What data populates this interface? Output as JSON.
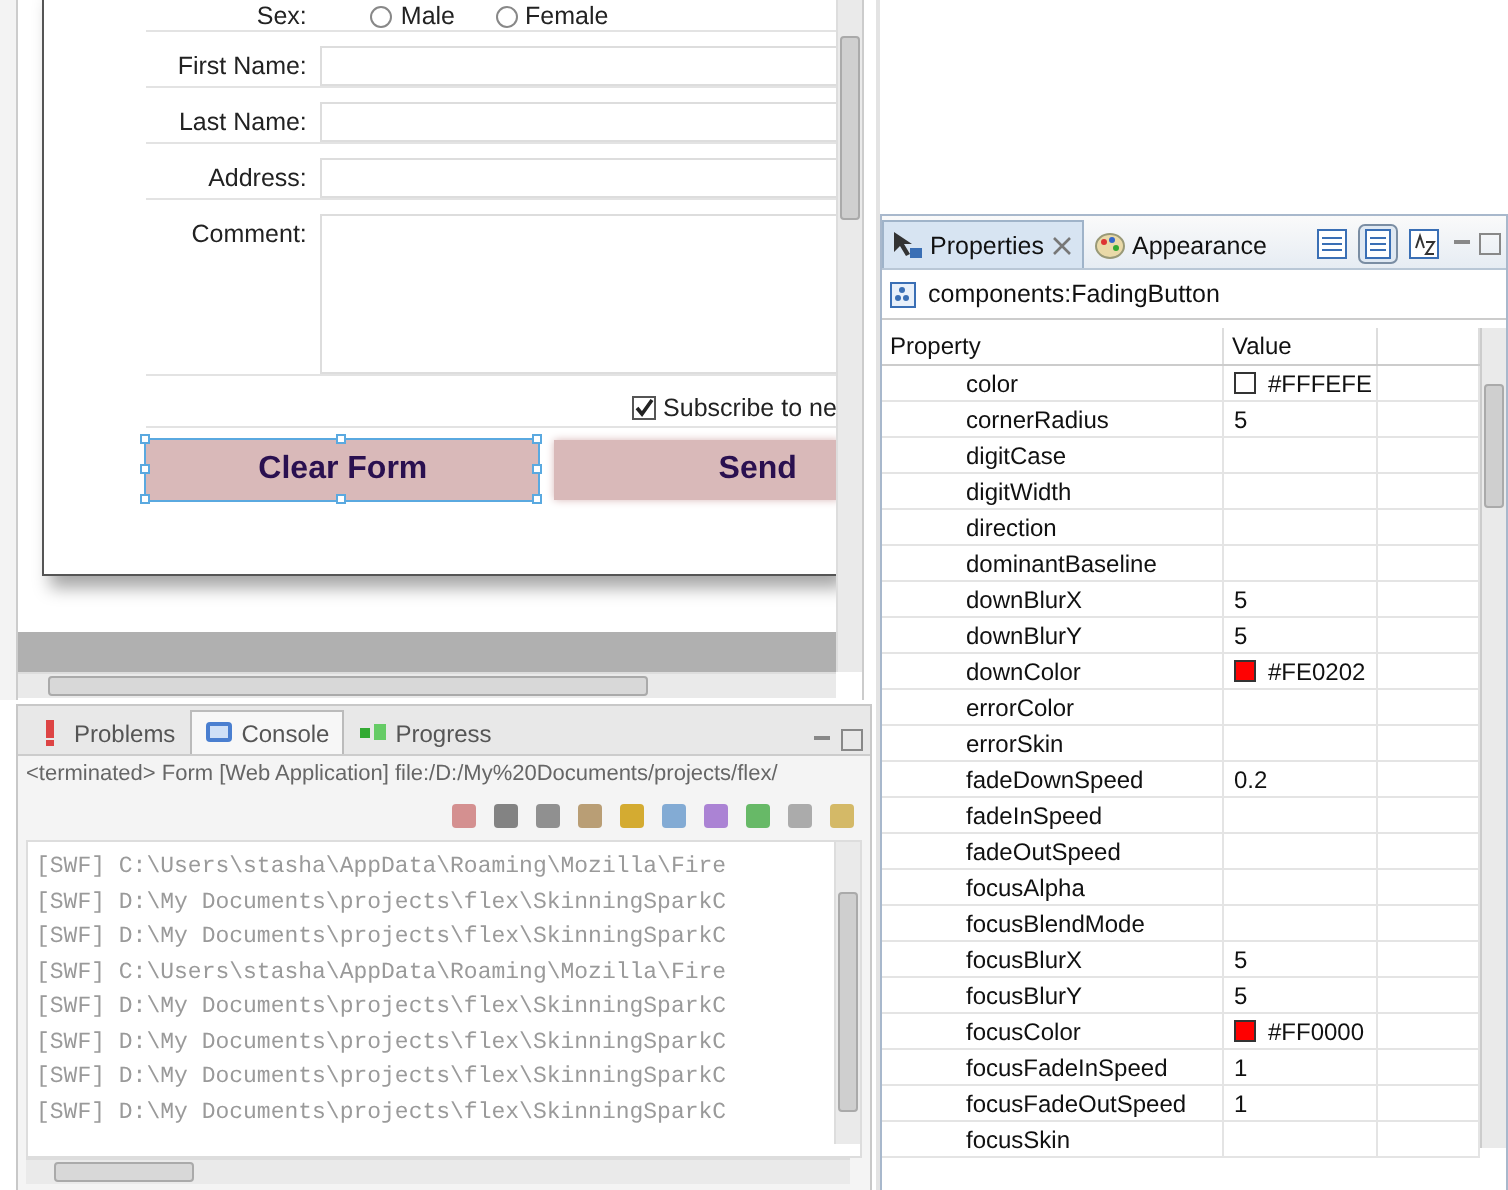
{
  "form": {
    "sex_label": "Sex:",
    "sex_options": [
      {
        "label": "Male",
        "selected": false
      },
      {
        "label": "Female",
        "selected": false
      }
    ],
    "fields": [
      {
        "label": "First Name:",
        "kind": "text"
      },
      {
        "label": "Last Name:",
        "kind": "text"
      },
      {
        "label": "Address:",
        "kind": "text"
      },
      {
        "label": "Comment:",
        "kind": "textarea"
      }
    ],
    "subscribe": {
      "label": "Subscribe to ne",
      "checked": true
    },
    "buttons": [
      {
        "label": "Clear Form",
        "selected": true
      },
      {
        "label": "Send",
        "selected": false
      }
    ]
  },
  "console": {
    "tabs": [
      {
        "label": "Problems",
        "selected": false
      },
      {
        "label": "Console",
        "selected": true
      },
      {
        "label": "Progress",
        "selected": false
      }
    ],
    "status": "<terminated> Form [Web Application] file:/D:/My%20Documents/projects/flex/",
    "lines": [
      "[SWF] C:\\Users\\stasha\\AppData\\Roaming\\Mozilla\\Fire",
      "[SWF] D:\\My Documents\\projects\\flex\\SkinningSparkC",
      "[SWF] D:\\My Documents\\projects\\flex\\SkinningSparkC",
      "[SWF] C:\\Users\\stasha\\AppData\\Roaming\\Mozilla\\Fire",
      "[SWF] D:\\My Documents\\projects\\flex\\SkinningSparkC",
      "[SWF] D:\\My Documents\\projects\\flex\\SkinningSparkC",
      "[SWF] D:\\My Documents\\projects\\flex\\SkinningSparkC",
      "[SWF] D:\\My Documents\\projects\\flex\\SkinningSparkC"
    ]
  },
  "properties": {
    "tabs": [
      {
        "label": "Properties",
        "selected": true
      },
      {
        "label": "Appearance",
        "selected": false
      }
    ],
    "component": "components:FadingButton",
    "columns": [
      "Property",
      "Value"
    ],
    "rows": [
      {
        "name": "color",
        "value": "#FFFEFE",
        "color": "#fffefe"
      },
      {
        "name": "cornerRadius",
        "value": "5"
      },
      {
        "name": "digitCase"
      },
      {
        "name": "digitWidth"
      },
      {
        "name": "direction"
      },
      {
        "name": "dominantBaseline"
      },
      {
        "name": "downBlurX",
        "value": "5"
      },
      {
        "name": "downBlurY",
        "value": "5"
      },
      {
        "name": "downColor",
        "value": "#FE0202",
        "color": "#fe0202"
      },
      {
        "name": "errorColor"
      },
      {
        "name": "errorSkin"
      },
      {
        "name": "fadeDownSpeed",
        "value": "0.2"
      },
      {
        "name": "fadeInSpeed"
      },
      {
        "name": "fadeOutSpeed"
      },
      {
        "name": "focusAlpha"
      },
      {
        "name": "focusBlendMode"
      },
      {
        "name": "focusBlurX",
        "value": "5"
      },
      {
        "name": "focusBlurY",
        "value": "5"
      },
      {
        "name": "focusColor",
        "value": "#FF0000",
        "color": "#ff0000"
      },
      {
        "name": "focusFadeInSpeed",
        "value": "1"
      },
      {
        "name": "focusFadeOutSpeed",
        "value": "1"
      },
      {
        "name": "focusSkin"
      }
    ]
  }
}
